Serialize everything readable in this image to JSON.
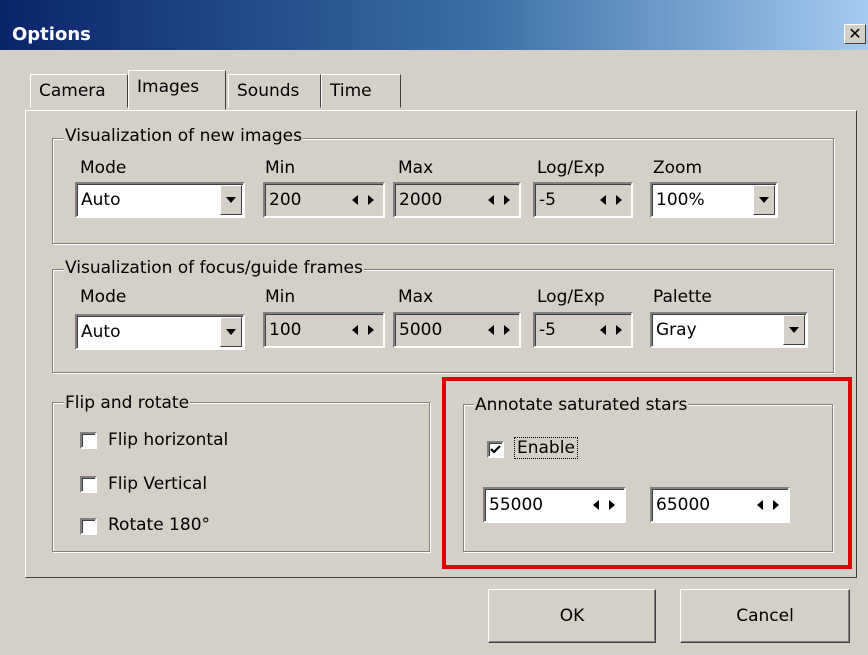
{
  "window": {
    "title": "Options"
  },
  "tabs": [
    "Camera",
    "Images",
    "Sounds",
    "Time"
  ],
  "new_images": {
    "title": "Visualization of new images",
    "labels": {
      "mode": "Mode",
      "min": "Min",
      "max": "Max",
      "logexp": "Log/Exp",
      "zoom": "Zoom"
    },
    "mode": "Auto",
    "min": "200",
    "max": "2000",
    "logexp": "-5",
    "zoom": "100%"
  },
  "focus_frames": {
    "title": "Visualization of focus/guide frames",
    "labels": {
      "mode": "Mode",
      "min": "Min",
      "max": "Max",
      "logexp": "Log/Exp",
      "palette": "Palette"
    },
    "mode": "Auto",
    "min": "100",
    "max": "5000",
    "logexp": "-5",
    "palette": "Gray"
  },
  "flip": {
    "title": "Flip and rotate",
    "flip_horizontal": "Flip horizontal",
    "flip_vertical": "Flip Vertical",
    "rotate": "Rotate 180°"
  },
  "annotate": {
    "title": "Annotate saturated stars",
    "enable": "Enable",
    "enable_checked": true,
    "low": "55000",
    "high": "65000"
  },
  "buttons": {
    "ok": "OK",
    "cancel": "Cancel"
  },
  "highlight_color": "#e00000"
}
